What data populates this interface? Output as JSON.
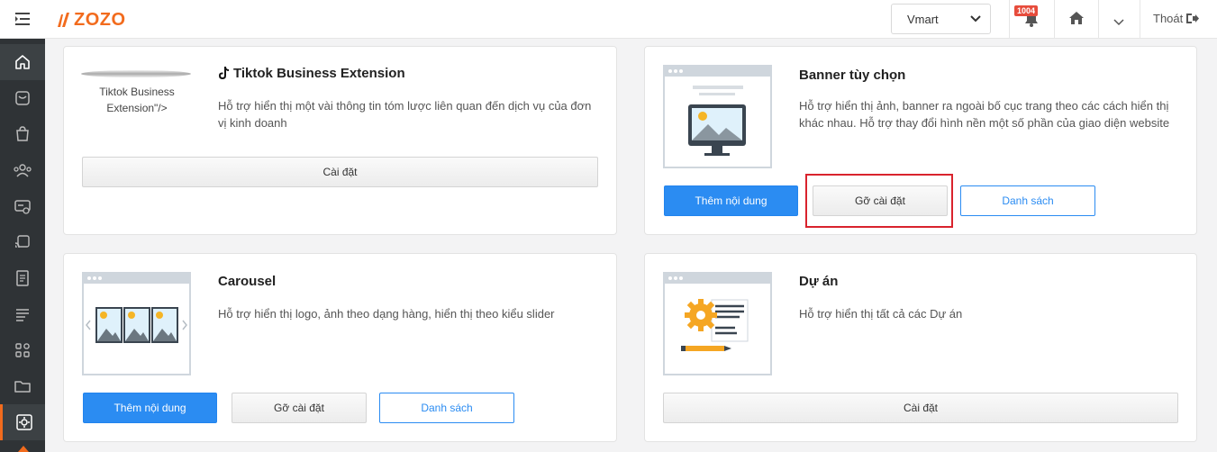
{
  "header": {
    "logo_text": "ZOZO",
    "store_select_value": "Vmart",
    "notification_count": "1004",
    "logout_label": "Thoát"
  },
  "colors": {
    "brand": "#f26b1d",
    "primary": "#2b8cf2",
    "sidebar_bg": "#2f3336",
    "highlight": "#d9232d"
  },
  "sidebar": {
    "items": [
      {
        "icon": "home-icon"
      },
      {
        "icon": "inbox-icon"
      },
      {
        "icon": "shopping-bag-icon"
      },
      {
        "icon": "users-icon"
      },
      {
        "icon": "coupon-icon"
      },
      {
        "icon": "cast-icon"
      },
      {
        "icon": "document-icon"
      },
      {
        "icon": "list-icon"
      },
      {
        "icon": "apps-icon"
      },
      {
        "icon": "folder-icon"
      },
      {
        "icon": "settings-icon"
      }
    ]
  },
  "cards": {
    "tiktok": {
      "title": "Tiktok Business Extension",
      "thumb_alt_line1": "Tiktok Business",
      "thumb_alt_line2": "Extension\"/>",
      "description": "Hỗ trợ hiển thị một vài thông tin tóm lược liên quan đến dịch vụ của đơn vị kinh doanh",
      "install_label": "Cài đặt"
    },
    "banner": {
      "title": "Banner tùy chọn",
      "description": "Hỗ trợ hiển thị ảnh, banner ra ngoài bố cục trang theo các cách hiển thị khác nhau. Hỗ trợ thay đổi hình nền một số phần của giao diện website",
      "add_content_label": "Thêm nội dung",
      "uninstall_label": "Gỡ cài đặt",
      "list_label": "Danh sách"
    },
    "carousel": {
      "title": "Carousel",
      "description": "Hỗ trợ hiển thị logo, ảnh theo dạng hàng, hiển thị theo kiểu slider",
      "add_content_label": "Thêm nội dung",
      "uninstall_label": "Gỡ cài đặt",
      "list_label": "Danh sách"
    },
    "project": {
      "title": "Dự án",
      "description": "Hỗ trợ hiển thị tất cả các Dự án",
      "install_label": "Cài đặt"
    }
  }
}
